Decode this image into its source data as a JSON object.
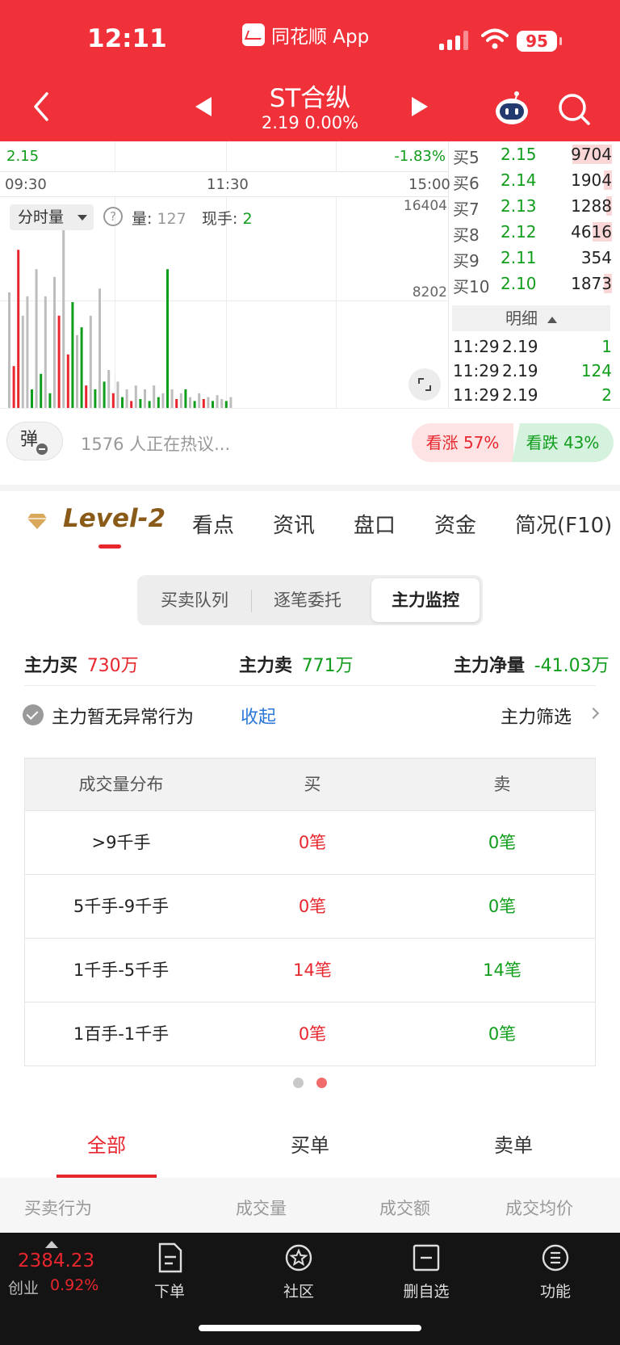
{
  "status_bar": {
    "time": "12:11",
    "app_name": "同花顺 App",
    "battery": "95"
  },
  "header": {
    "stock_name": "ST合纵",
    "price_line": "2.19 0.00%"
  },
  "chart": {
    "low_price": "2.15",
    "low_pct": "-1.83%",
    "times": [
      "09:30",
      "11:30",
      "15:00"
    ],
    "vol_selector": "分时量",
    "vol_label": "量:",
    "vol_value": "127",
    "hand_label": "现手:",
    "hand_value": "2",
    "vol_max": "16404",
    "vol_mid": "8202",
    "bars": [
      {
        "v": 0.6,
        "c": "gray"
      },
      {
        "v": 0.22,
        "c": "red"
      },
      {
        "v": 0.82,
        "c": "red"
      },
      {
        "v": 0.48,
        "c": "gray"
      },
      {
        "v": 0.58,
        "c": "gray"
      },
      {
        "v": 0.1,
        "c": "green"
      },
      {
        "v": 0.72,
        "c": "gray"
      },
      {
        "v": 0.18,
        "c": "green"
      },
      {
        "v": 0.58,
        "c": "gray"
      },
      {
        "v": 0.08,
        "c": "green"
      },
      {
        "v": 0.68,
        "c": "gray"
      },
      {
        "v": 0.48,
        "c": "red"
      },
      {
        "v": 1.0,
        "c": "gray"
      },
      {
        "v": 0.28,
        "c": "red"
      },
      {
        "v": 0.55,
        "c": "green"
      },
      {
        "v": 0.38,
        "c": "gray"
      },
      {
        "v": 0.42,
        "c": "green"
      },
      {
        "v": 0.12,
        "c": "red"
      },
      {
        "v": 0.48,
        "c": "gray"
      },
      {
        "v": 0.1,
        "c": "green"
      },
      {
        "v": 0.62,
        "c": "gray"
      },
      {
        "v": 0.14,
        "c": "green"
      },
      {
        "v": 0.2,
        "c": "gray"
      },
      {
        "v": 0.08,
        "c": "red"
      },
      {
        "v": 0.14,
        "c": "gray"
      },
      {
        "v": 0.06,
        "c": "green"
      },
      {
        "v": 0.1,
        "c": "gray"
      },
      {
        "v": 0.04,
        "c": "red"
      },
      {
        "v": 0.12,
        "c": "gray"
      },
      {
        "v": 0.05,
        "c": "green"
      },
      {
        "v": 0.1,
        "c": "gray"
      },
      {
        "v": 0.04,
        "c": "green"
      },
      {
        "v": 0.12,
        "c": "gray"
      },
      {
        "v": 0.06,
        "c": "green"
      },
      {
        "v": 0.08,
        "c": "gray"
      },
      {
        "v": 0.72,
        "c": "green"
      },
      {
        "v": 0.1,
        "c": "gray"
      },
      {
        "v": 0.05,
        "c": "red"
      },
      {
        "v": 0.08,
        "c": "gray"
      },
      {
        "v": 0.1,
        "c": "green"
      },
      {
        "v": 0.06,
        "c": "gray"
      },
      {
        "v": 0.04,
        "c": "green"
      },
      {
        "v": 0.08,
        "c": "gray"
      },
      {
        "v": 0.05,
        "c": "red"
      },
      {
        "v": 0.06,
        "c": "gray"
      },
      {
        "v": 0.04,
        "c": "green"
      },
      {
        "v": 0.07,
        "c": "gray"
      },
      {
        "v": 0.05,
        "c": "gray"
      },
      {
        "v": 0.04,
        "c": "green"
      },
      {
        "v": 0.06,
        "c": "gray"
      }
    ]
  },
  "order_book": [
    {
      "label": "买5",
      "price": "2.15",
      "qty": "9704",
      "fill": 0.95
    },
    {
      "label": "买6",
      "price": "2.14",
      "qty": "1904",
      "fill": 0.2
    },
    {
      "label": "买7",
      "price": "2.13",
      "qty": "1288",
      "fill": 0.13
    },
    {
      "label": "买8",
      "price": "2.12",
      "qty": "4616",
      "fill": 0.47
    },
    {
      "label": "买9",
      "price": "2.11",
      "qty": "354",
      "fill": 0.0
    },
    {
      "label": "买10",
      "price": "2.10",
      "qty": "1873",
      "fill": 0.19
    }
  ],
  "detail_label": "明细",
  "ticks": [
    {
      "time": "11:29",
      "price": "2.19",
      "qty": "1"
    },
    {
      "time": "11:29",
      "price": "2.19",
      "qty": "124"
    },
    {
      "time": "11:29",
      "price": "2.19",
      "qty": "2"
    }
  ],
  "discussion": {
    "danmu_label": "弹",
    "text": "1576 人正在热议...",
    "bull": "看涨 57%",
    "bear": "看跌 43%"
  },
  "tabs": {
    "level2": "Level-2",
    "items": [
      "看点",
      "资讯",
      "盘口",
      "资金",
      "简况(F10)"
    ]
  },
  "segments": [
    "买卖队列",
    "逐笔委托",
    "主力监控"
  ],
  "summary": {
    "buy_label": "主力买",
    "buy_value": "730万",
    "sell_label": "主力卖",
    "sell_value": "771万",
    "net_label": "主力净量",
    "net_value": "-41.03万"
  },
  "monitor": {
    "status": "主力暂无异常行为",
    "collapse": "收起",
    "filter": "主力筛选"
  },
  "table": {
    "headers": [
      "成交量分布",
      "买",
      "卖"
    ],
    "rows": [
      {
        "range": ">9千手",
        "buy": "0笔",
        "sell": "0笔"
      },
      {
        "range": "5千手-9千手",
        "buy": "0笔",
        "sell": "0笔"
      },
      {
        "range": "1千手-5千手",
        "buy": "14笔",
        "sell": "14笔"
      },
      {
        "range": "1百手-1千手",
        "buy": "0笔",
        "sell": "0笔"
      }
    ]
  },
  "sub_tabs": [
    "全部",
    "买单",
    "卖单"
  ],
  "list_headers": [
    "买卖行为",
    "成交量",
    "成交额",
    "成交均价"
  ],
  "bottom": {
    "index_value": "2384.23",
    "index_name": "创业",
    "index_pct": "0.92%",
    "nav": [
      "下单",
      "社区",
      "删自选",
      "功能"
    ]
  },
  "colors": {
    "brand_red": "#f0313a",
    "up": "#e8262d",
    "down": "#109d1b",
    "link": "#2b78d8"
  }
}
